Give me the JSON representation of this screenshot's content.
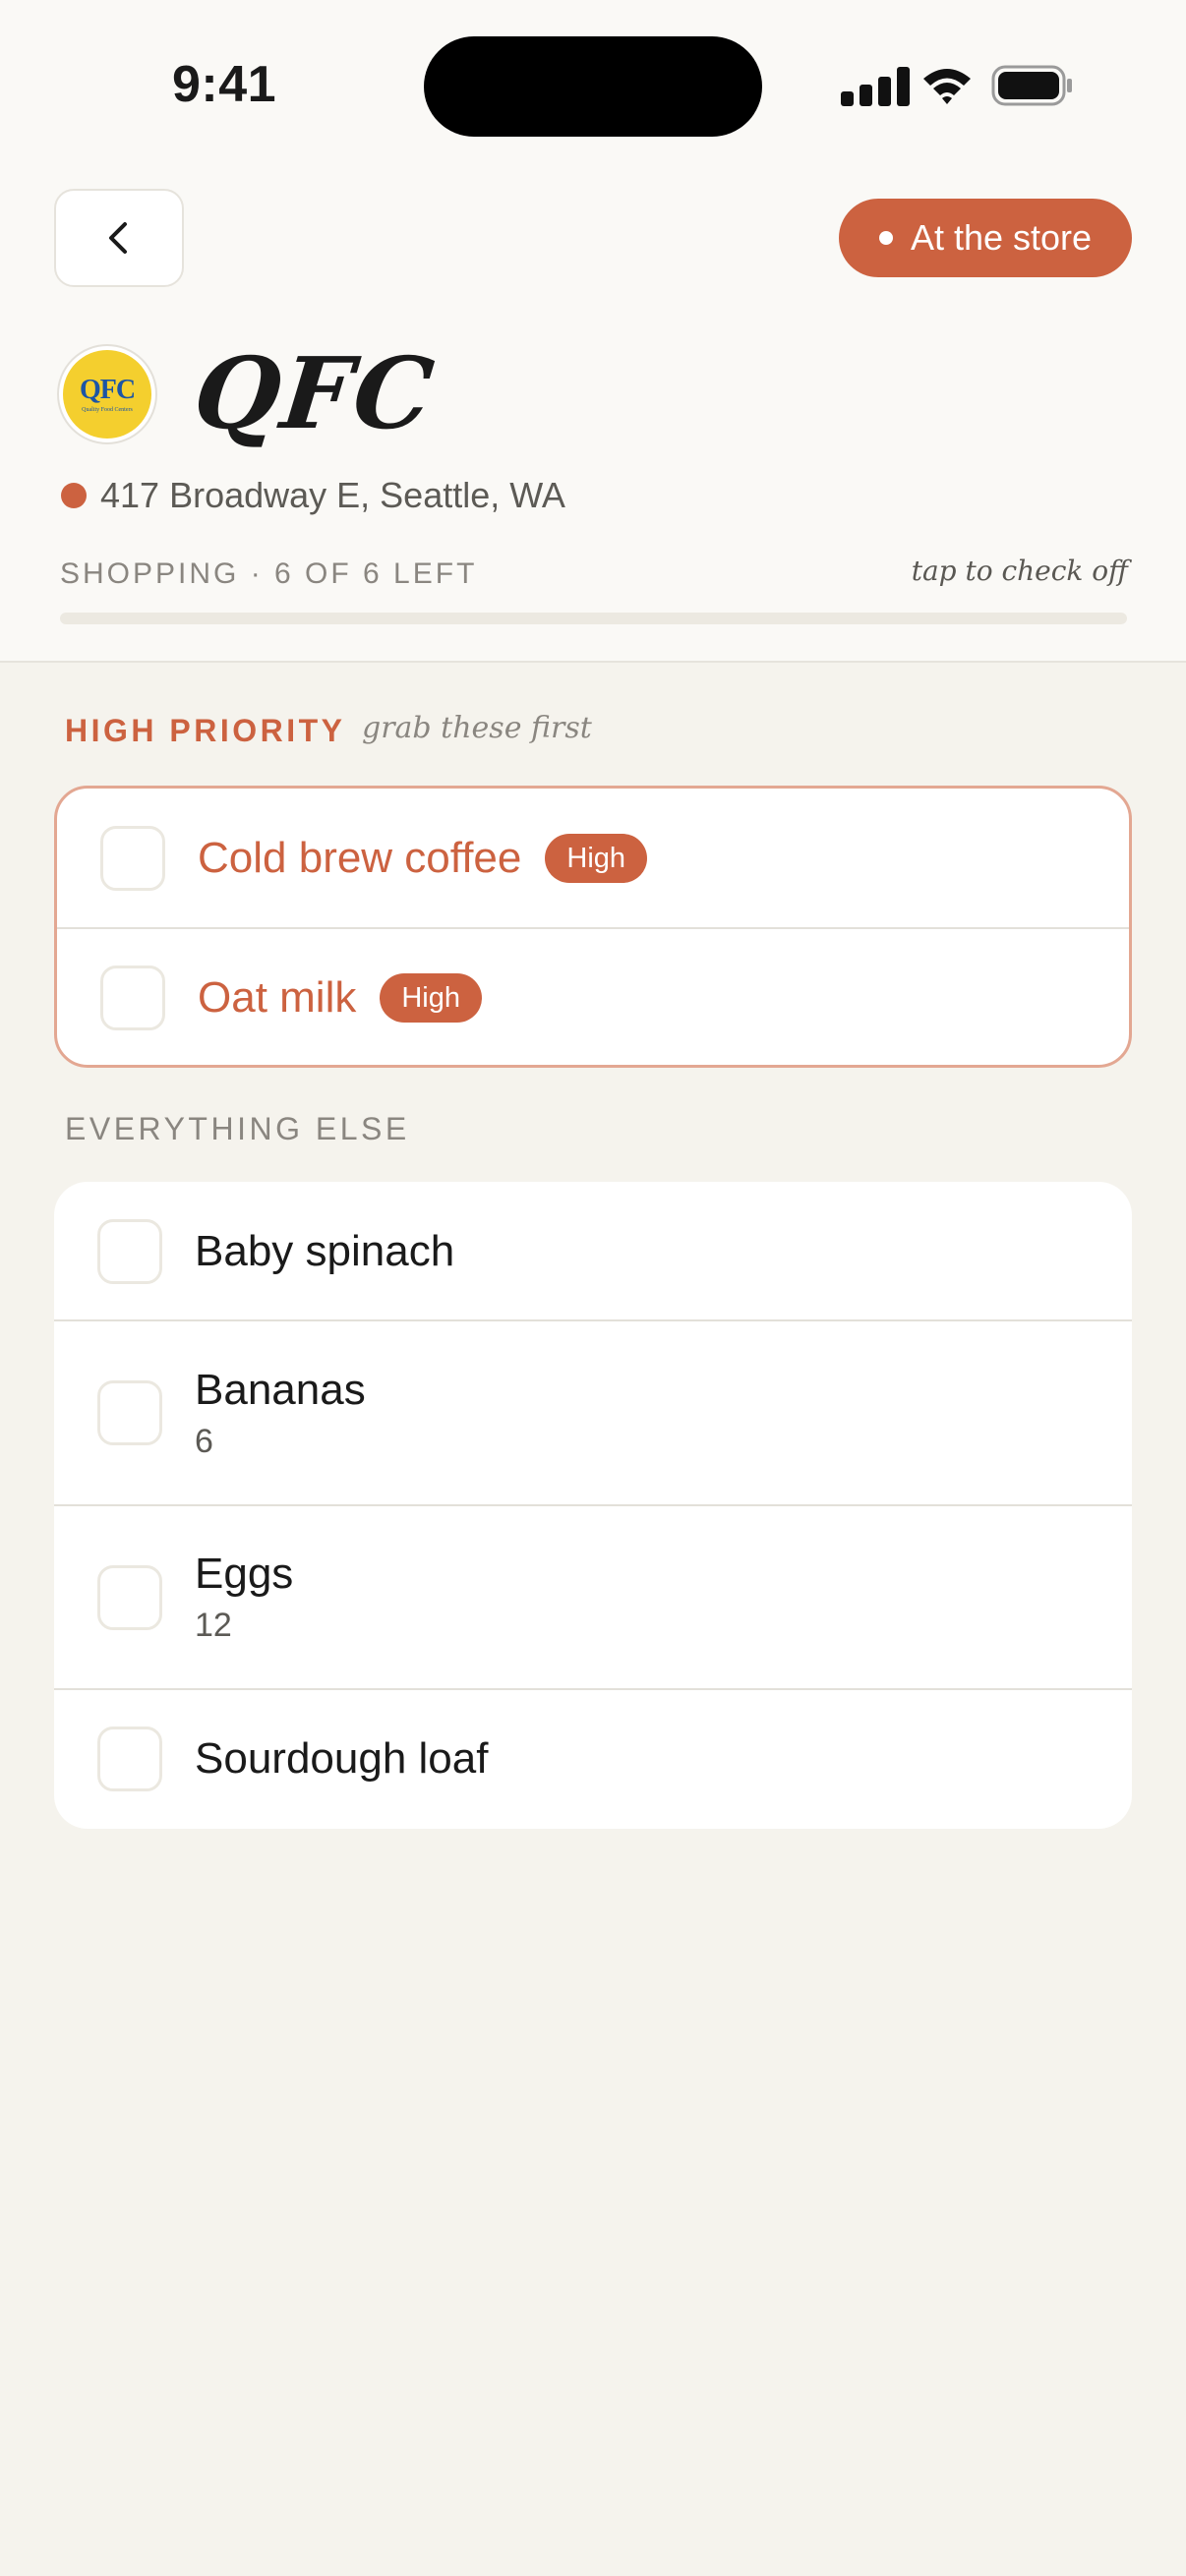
{
  "status_bar": {
    "time": "9:41"
  },
  "header": {
    "status_pill": "At the store",
    "store_name": "QFC",
    "logo_text": "QFC",
    "logo_tagline": "Quality Food Centers",
    "address": "417 Broadway E, Seattle, WA",
    "progress_label": "SHOPPING · 6 OF 6 LEFT",
    "progress_fraction": 0,
    "tap_hint": "tap to check off"
  },
  "high_priority": {
    "title": "HIGH PRIORITY",
    "note": "grab these first",
    "items": [
      {
        "name": "Cold brew coffee",
        "badge": "High"
      },
      {
        "name": "Oat milk",
        "badge": "High"
      }
    ]
  },
  "everything_else": {
    "title": "EVERYTHING ELSE",
    "items": [
      {
        "name": "Baby spinach",
        "qty": ""
      },
      {
        "name": "Bananas",
        "qty": "6"
      },
      {
        "name": "Eggs",
        "qty": "12"
      },
      {
        "name": "Sourdough loaf",
        "qty": ""
      }
    ]
  },
  "colors": {
    "accent": "#cc6240",
    "background": "#f5f3ed"
  }
}
